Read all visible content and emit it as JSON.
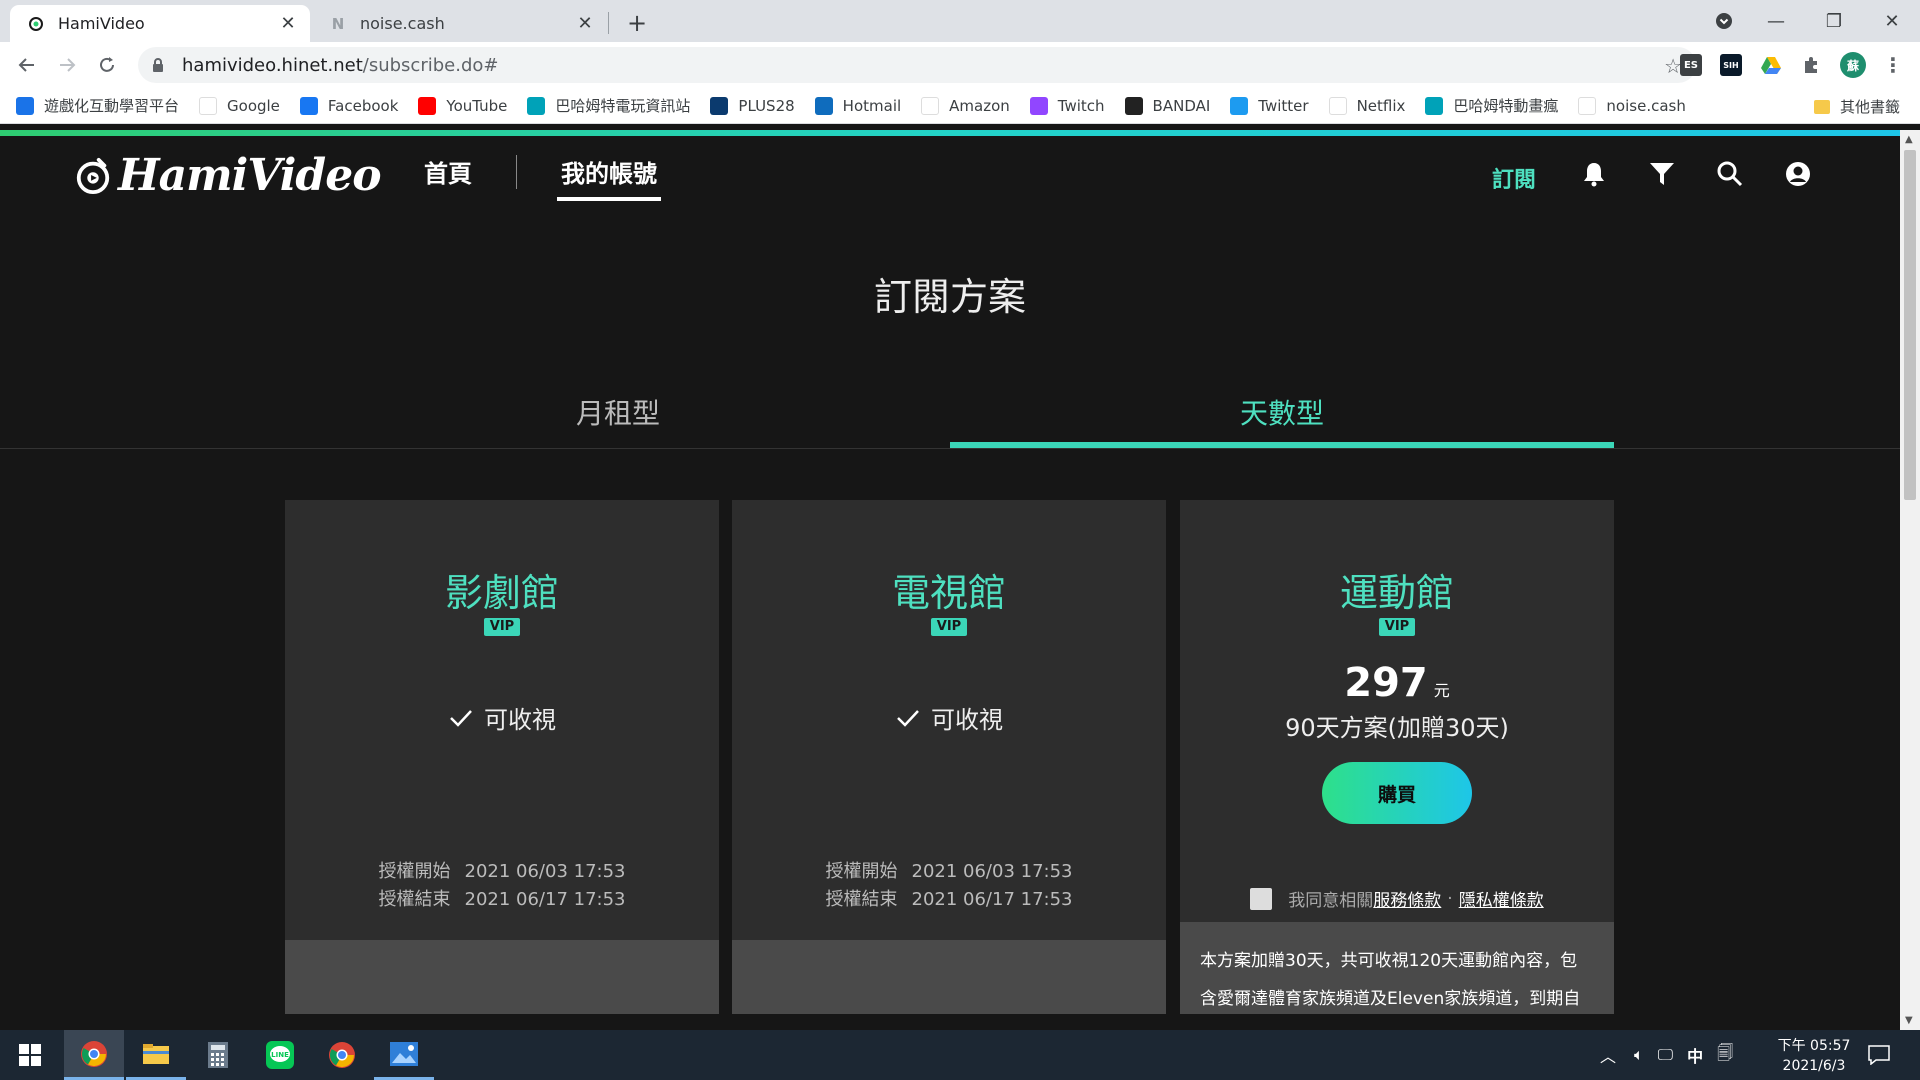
{
  "browser": {
    "tabs": [
      {
        "title": "HamiVideo",
        "active": true
      },
      {
        "title": "noise.cash",
        "active": false
      }
    ],
    "url_host": "hamivideo.hinet.net",
    "url_path": "/subscribe.do#",
    "extensions": [
      "ES",
      "SIH"
    ],
    "profile_initial": "蘇",
    "bookmarks": [
      {
        "label": "遊戲化互動學習平台",
        "icon": "learning-icon",
        "color": "#1a73e8"
      },
      {
        "label": "Google",
        "icon": "google-icon",
        "color": "#ffffff"
      },
      {
        "label": "Facebook",
        "icon": "facebook-icon",
        "color": "#1877f2"
      },
      {
        "label": "YouTube",
        "icon": "youtube-icon",
        "color": "#ff0000"
      },
      {
        "label": "巴哈姆特電玩資訊站",
        "icon": "bahamut-icon",
        "color": "#00a2b8"
      },
      {
        "label": "PLUS28",
        "icon": "plus28-icon",
        "color": "#0b3a6e"
      },
      {
        "label": "Hotmail",
        "icon": "outlook-icon",
        "color": "#0f6cbd"
      },
      {
        "label": "Amazon",
        "icon": "amazon-icon",
        "color": "#ffffff"
      },
      {
        "label": "Twitch",
        "icon": "twitch-icon",
        "color": "#9146ff"
      },
      {
        "label": "BANDAI",
        "icon": "bandai-icon",
        "color": "#222222"
      },
      {
        "label": "Twitter",
        "icon": "twitter-icon",
        "color": "#1d9bf0"
      },
      {
        "label": "Netflix",
        "icon": "netflix-icon",
        "color": "#ffffff"
      },
      {
        "label": "巴哈姆特動畫瘋",
        "icon": "bahamut-anime-icon",
        "color": "#00a2b8"
      },
      {
        "label": "noise.cash",
        "icon": "noise-cash-icon",
        "color": "#ffffff"
      }
    ],
    "other_bookmarks": "其他書籤"
  },
  "site": {
    "logo_text": "HamiVideo",
    "nav": [
      {
        "label": "首頁",
        "active": false
      },
      {
        "label": "我的帳號",
        "active": true
      }
    ],
    "subscribe_link": "訂閱",
    "accent_color": "#4ee0c0"
  },
  "page": {
    "title": "訂閱方案",
    "plan_tabs": [
      {
        "label": "月租型",
        "active": false
      },
      {
        "label": "天數型",
        "active": true
      }
    ],
    "cards": [
      {
        "name": "影劇館",
        "badge": "VIP",
        "status": "可收視",
        "auth_start_label": "授權開始",
        "auth_start": "2021 06/03 17:53",
        "auth_end_label": "授權結束",
        "auth_end": "2021 06/17 17:53"
      },
      {
        "name": "電視館",
        "badge": "VIP",
        "status": "可收視",
        "auth_start_label": "授權開始",
        "auth_start": "2021 06/03 17:53",
        "auth_end_label": "授權結束",
        "auth_end": "2021 06/17 17:53"
      },
      {
        "name": "運動館",
        "badge": "VIP",
        "price": "297",
        "price_unit": "元",
        "plan_desc": "90天方案(加贈30天)",
        "buy_label": "購買",
        "agree_prefix": "我同意相關",
        "terms_link": "服務條款",
        "agree_sep": "·",
        "privacy_link": "隱私權條款",
        "promo_line1": "本方案加贈30天，共可收視120天運動館內容，包",
        "promo_line2": "含愛爾達體育家族頻道及Eleven家族頻道，到期自"
      }
    ]
  },
  "taskbar": {
    "apps": [
      "chrome-icon",
      "file-explorer-icon",
      "calculator-icon",
      "line-icon",
      "chrome-icon",
      "photos-icon"
    ],
    "ime": "中",
    "time": "下午 05:57",
    "date": "2021/6/3"
  }
}
